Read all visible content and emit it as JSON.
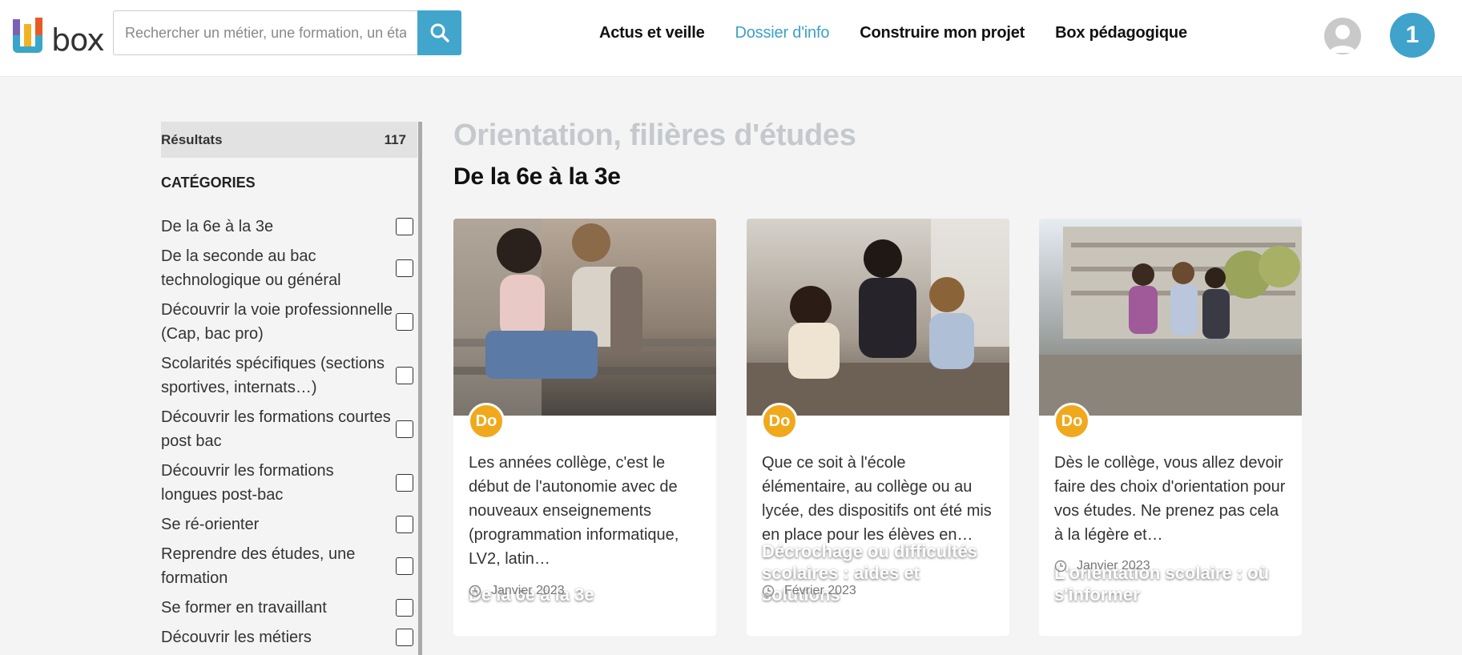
{
  "header": {
    "logo_text": "box",
    "search_placeholder": "Rechercher un métier, une formation, un établissement",
    "nav": [
      {
        "label": "Actus et veille",
        "active": false
      },
      {
        "label": "Dossier d'info",
        "active": true
      },
      {
        "label": "Construire mon projet",
        "active": false
      },
      {
        "label": "Box pédagogique",
        "active": false
      }
    ],
    "notification_count": "1",
    "accent_color": "#42a5cc"
  },
  "sidebar": {
    "results_label": "Résultats",
    "results_count": "117",
    "categories_title": "CATÉGORIES",
    "categories": [
      "De la 6e à la 3e",
      "De la seconde au bac technologique ou général",
      "Découvrir la voie professionnelle (Cap, bac pro)",
      "Scolarités spécifiques (sections sportives, internats…)",
      "Découvrir les formations courtes post bac",
      "Découvrir les formations longues post-bac",
      "Se ré-orienter",
      "Reprendre des études, une formation",
      "Se former en travaillant",
      "Découvrir les métiers"
    ]
  },
  "main": {
    "section_title": "Orientation, filières d'études",
    "subtitle": "De la 6e à la 3e",
    "cards": [
      {
        "title": "De la 6e à la 3e",
        "tag": "Do",
        "description": "Les années collège, c'est le début de l'autonomie avec de nouveaux enseignements (programmation informatique, LV2, latin…",
        "date": "Janvier 2023"
      },
      {
        "title": "Décrochage ou difficultés scolaires : aides et solutions",
        "tag": "Do",
        "description": "Que ce soit à l'école élémentaire, au collège ou au lycée, des dispositifs ont été mis en place pour les élèves en…",
        "date": "Février 2023"
      },
      {
        "title": "L'orientation scolaire : où s'informer",
        "tag": "Do",
        "description": "Dès le collège, vous allez devoir faire des choix d'orientation pour vos études. Ne prenez pas cela à la légère et…",
        "date": "Janvier 2023"
      }
    ]
  }
}
